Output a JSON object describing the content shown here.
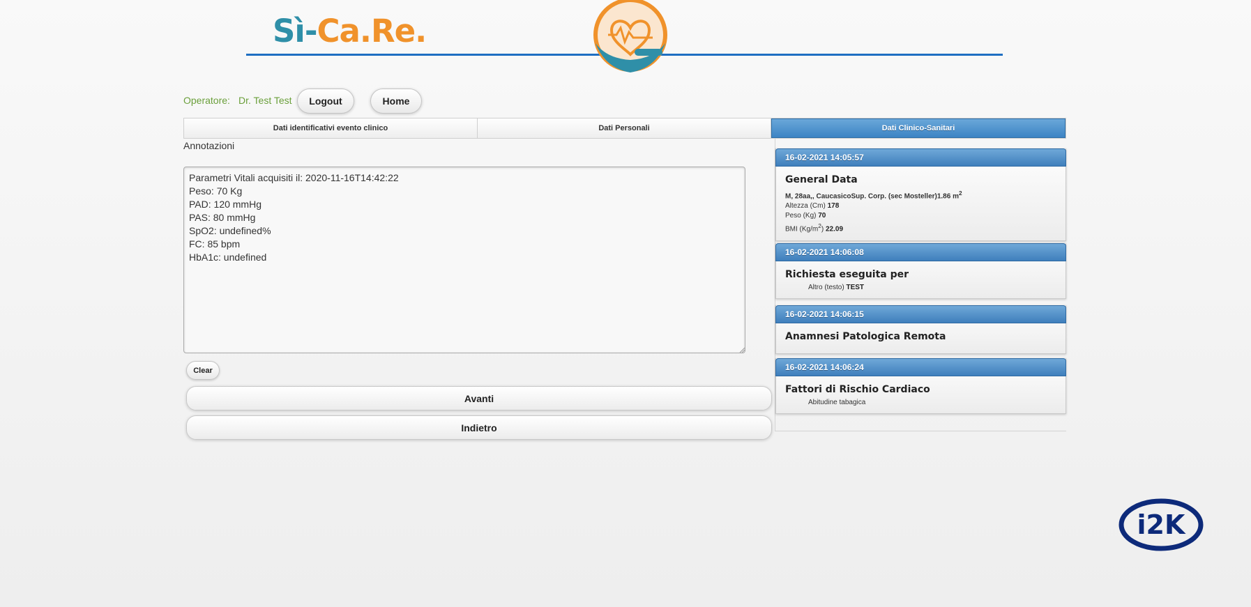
{
  "brand": {
    "part1": "Sì-",
    "part2": "Ca.Re."
  },
  "partner_logo_text": "i2K",
  "operator": {
    "label": "Operatore:",
    "name": "Dr. Test Test"
  },
  "nav": {
    "logout_label": "Logout",
    "home_label": "Home"
  },
  "tabs": [
    {
      "label": "Dati identificativi evento clinico",
      "active": false
    },
    {
      "label": "Dati Personali",
      "active": false
    },
    {
      "label": "Dati Clinico-Sanitari",
      "active": true
    }
  ],
  "annotations": {
    "label": "Annotazioni",
    "text": "Parametri Vitali acquisiti il: 2020-11-16T14:42:22\nPeso: 70 Kg\nPAD: 120 mmHg\nPAS: 80 mmHg\nSpO2: undefined%\nFC: 85 bpm\nHbA1c: undefined",
    "clear_label": "Clear"
  },
  "actions": {
    "next_label": "Avanti",
    "back_label": "Indietro"
  },
  "history": [
    {
      "timestamp": "16-02-2021 14:05:57",
      "title": "General Data",
      "summary": "M, 28aa,, CaucasicoSup. Corp. (sec Mosteller)1.86 m",
      "summary_sup": "2",
      "height_label": "Altezza (Cm)",
      "height_value": "178",
      "weight_label": "Peso (Kg)",
      "weight_value": "70",
      "bmi_label_a": "BMI (Kg/m",
      "bmi_label_sup": "2",
      "bmi_label_b": ")",
      "bmi_value": "22.09"
    },
    {
      "timestamp": "16-02-2021 14:06:08",
      "title": "Richiesta eseguita per",
      "detail_label": "Altro (testo)",
      "detail_value": "TEST"
    },
    {
      "timestamp": "16-02-2021 14:06:15",
      "title": "Anamnesi Patologica Remota"
    },
    {
      "timestamp": "16-02-2021 14:06:24",
      "title": "Fattori di Rischio Cardiaco",
      "detail_label": "Abitudine tabagica"
    }
  ],
  "colors": {
    "brand_teal": "#2f8fa8",
    "brand_orange": "#f0922b",
    "header_rule": "#1f6fc2",
    "operator_green": "#6a9f3a",
    "tab_active": "#3d84c4",
    "partner_navy": "#0d2a7a"
  }
}
